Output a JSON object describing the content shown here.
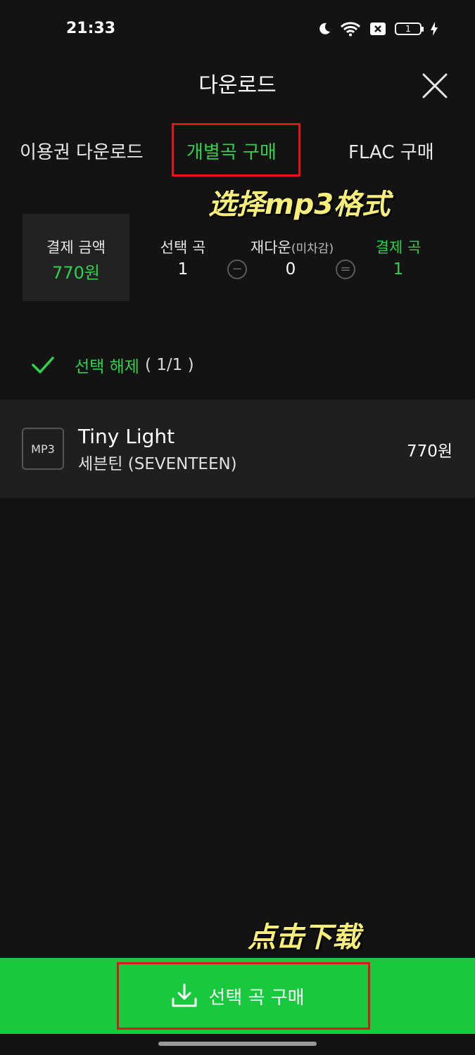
{
  "status_bar": {
    "time": "21:33",
    "battery_level": "1"
  },
  "header": {
    "title": "다운로드"
  },
  "tabs": [
    {
      "label": "이용권 다운로드"
    },
    {
      "label": "개별곡 구매",
      "active": true
    },
    {
      "label": "FLAC 구매"
    }
  ],
  "annotations": {
    "format": "选择mp3格式",
    "download": "点击下载"
  },
  "summary": {
    "payment_label": "결제 금액",
    "payment_value": "770원",
    "selected_label": "선택 곡",
    "selected_value": "1",
    "redownload_label": "재다운",
    "redownload_sub": "(미차감)",
    "redownload_value": "0",
    "paid_songs_label": "결제 곡",
    "paid_songs_value": "1"
  },
  "selection": {
    "deselect_label": "선택 해제",
    "count": "( 1/1 )"
  },
  "track": {
    "format": "MP3",
    "title": "Tiny Light",
    "artist": "세븐틴 (SEVENTEEN)",
    "price": "770원"
  },
  "footer": {
    "buy_label": "선택 곡 구매"
  },
  "colors": {
    "accent": "#2fd14d",
    "button": "#18c83d",
    "highlight": "#e0141c",
    "annotation": "#f7ef78"
  }
}
